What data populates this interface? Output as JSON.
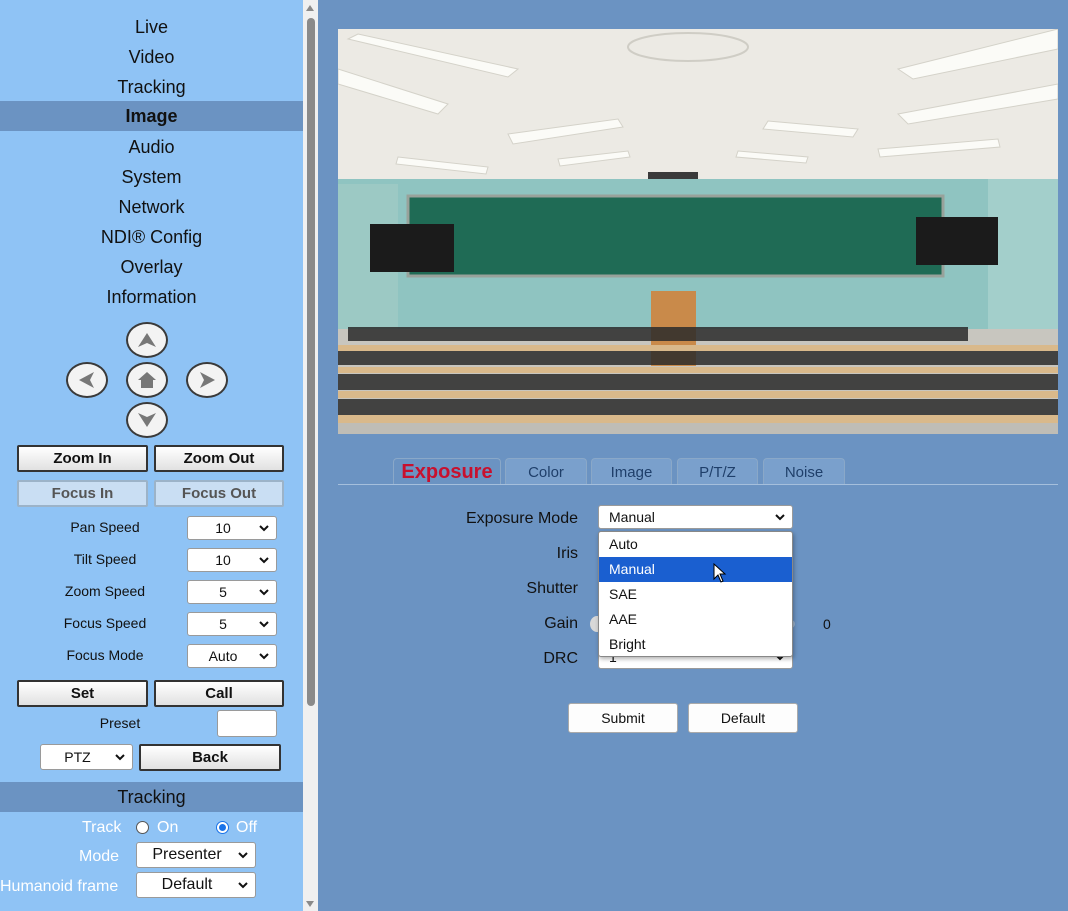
{
  "nav": {
    "items": [
      "Live",
      "Video",
      "Tracking",
      "Image",
      "Audio",
      "System",
      "Network",
      "NDI® Config",
      "Overlay",
      "Information"
    ],
    "active": "Image"
  },
  "ptz": {
    "zoom_in": "Zoom In",
    "zoom_out": "Zoom Out",
    "focus_in": "Focus In",
    "focus_out": "Focus Out",
    "pan_speed_label": "Pan Speed",
    "pan_speed": "10",
    "tilt_speed_label": "Tilt Speed",
    "tilt_speed": "10",
    "zoom_speed_label": "Zoom Speed",
    "zoom_speed": "5",
    "focus_speed_label": "Focus Speed",
    "focus_speed": "5",
    "focus_mode_label": "Focus Mode",
    "focus_mode": "Auto",
    "set": "Set",
    "call": "Call",
    "preset_label": "Preset",
    "preset_value": "",
    "mode_select": "PTZ",
    "back": "Back"
  },
  "tracking": {
    "header": "Tracking",
    "track_label": "Track",
    "on_label": "On",
    "off_label": "Off",
    "track_state": "off",
    "mode_label": "Mode",
    "mode_value": "Presenter",
    "frame_label": "Humanoid frame",
    "frame_value": "Default"
  },
  "tabs": {
    "items": [
      "Exposure",
      "Color",
      "Image",
      "P/T/Z",
      "Noise"
    ],
    "active": "Exposure"
  },
  "exposure": {
    "mode_label": "Exposure Mode",
    "mode_value": "Manual",
    "iris_label": "Iris",
    "shutter_label": "Shutter",
    "gain_label": "Gain",
    "gain_value": "0",
    "drc_label": "DRC",
    "drc_value": "1",
    "dropdown_options": [
      "Auto",
      "Manual",
      "SAE",
      "AAE",
      "Bright"
    ],
    "highlighted_option": "Manual"
  },
  "actions": {
    "submit": "Submit",
    "default": "Default"
  },
  "icons": {
    "up": "arrow-up-icon",
    "down": "arrow-down-icon",
    "left": "arrow-left-icon",
    "right": "arrow-right-icon",
    "home": "home-icon",
    "chevron": "chevron-down-icon"
  },
  "colors": {
    "sidebar_bg": "#8fc3f5",
    "main_bg": "#6b93c2",
    "active_tab_text": "#c8102e",
    "highlight": "#1a5fd0"
  }
}
